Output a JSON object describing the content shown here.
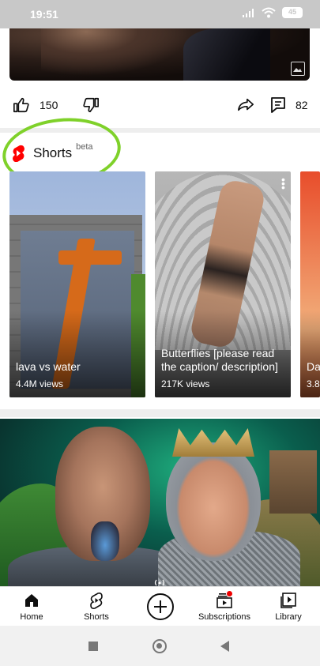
{
  "status_bar": {
    "time": "19:51",
    "battery": "45"
  },
  "video_actions": {
    "likes": "150",
    "comments": "82"
  },
  "shorts_shelf": {
    "title": "Shorts",
    "badge": "beta",
    "items": [
      {
        "title": "lava vs water",
        "views": "4.4M views"
      },
      {
        "title": "Butterflies [please read the caption/ description]",
        "views": "217K views"
      },
      {
        "title": "Da",
        "views": "3.8"
      }
    ]
  },
  "bottom_nav": {
    "items": [
      {
        "label": "Home",
        "icon": "home-icon"
      },
      {
        "label": "Shorts",
        "icon": "shorts-icon"
      },
      {
        "label": "",
        "icon": "add-icon"
      },
      {
        "label": "Subscriptions",
        "icon": "subscriptions-icon"
      },
      {
        "label": "Library",
        "icon": "library-icon"
      }
    ]
  },
  "colors": {
    "accent_red": "#ff0000",
    "annotation_green": "#7fd12a"
  }
}
